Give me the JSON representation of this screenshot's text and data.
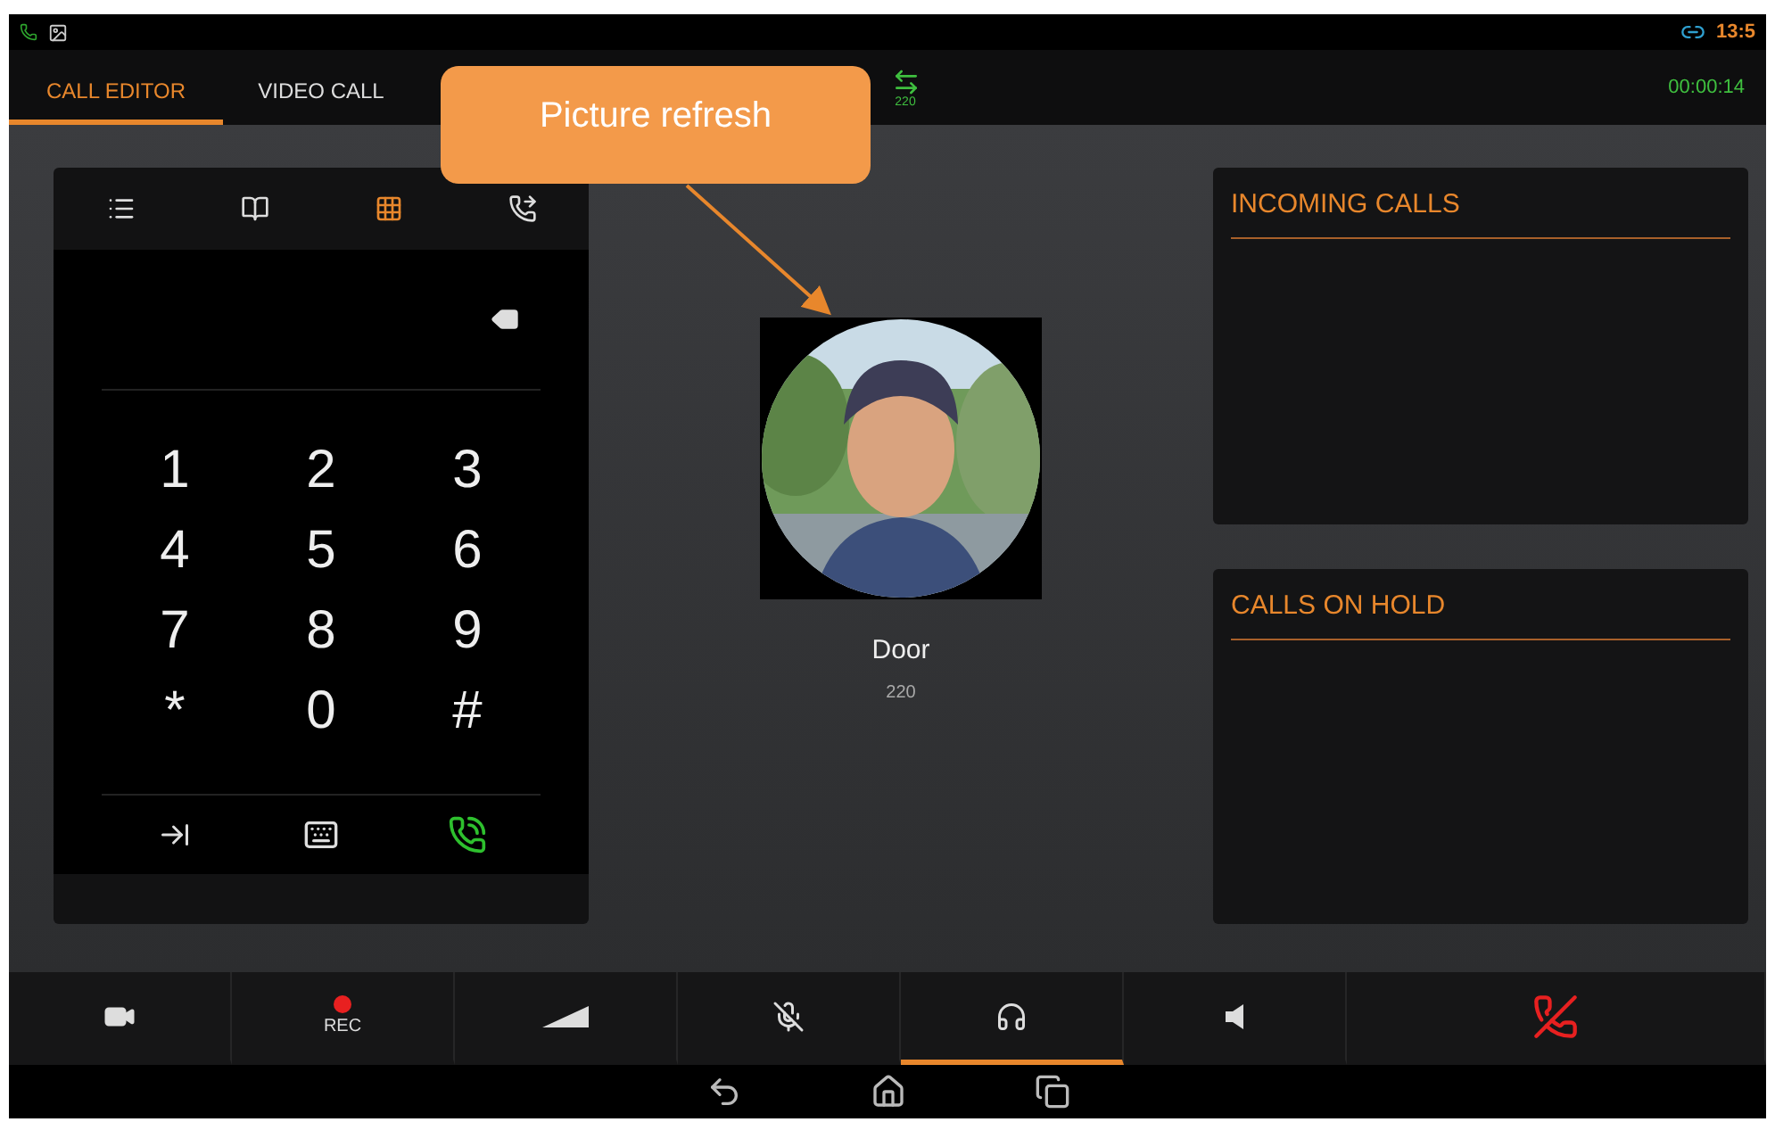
{
  "status_bar": {
    "time": "13:5"
  },
  "tabs": [
    {
      "label": "CALL EDITOR",
      "selected": true
    },
    {
      "label": "VIDEO CALL",
      "selected": false
    }
  ],
  "active_call": {
    "number": "220",
    "duration": "00:00:14"
  },
  "callout": {
    "text": "Picture refresh"
  },
  "dialer": {
    "modes": [
      {
        "kind": "list",
        "selected": false
      },
      {
        "kind": "contacts",
        "selected": false
      },
      {
        "kind": "keypad",
        "selected": true
      },
      {
        "kind": "transfer",
        "selected": false
      }
    ],
    "keys": [
      "1",
      "2",
      "3",
      "4",
      "5",
      "6",
      "7",
      "8",
      "9",
      "*",
      "0",
      "#"
    ]
  },
  "contact": {
    "name": "Door",
    "number": "220"
  },
  "panels": [
    {
      "title": "INCOMING CALLS"
    },
    {
      "title": "CALLS ON HOLD"
    }
  ],
  "toolbar": [
    {
      "kind": "video",
      "selected": false
    },
    {
      "kind": "record",
      "label": "REC",
      "selected": false
    },
    {
      "kind": "volume",
      "selected": false
    },
    {
      "kind": "mute",
      "selected": false
    },
    {
      "kind": "headset",
      "selected": true
    },
    {
      "kind": "speaker",
      "selected": false
    },
    {
      "kind": "hangup",
      "selected": false
    }
  ]
}
